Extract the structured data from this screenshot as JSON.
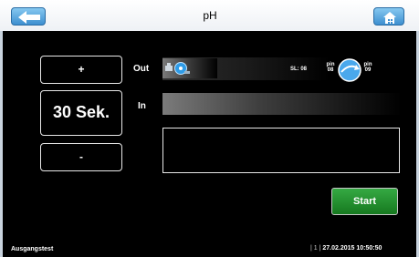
{
  "header": {
    "title": "pH"
  },
  "left_panel": {
    "plus_label": "+",
    "time_value": "30 Sek.",
    "minus_label": "-"
  },
  "out": {
    "label": "Out",
    "sl_label": "SL: 08",
    "pin_a": {
      "line1": "pin",
      "line2": "08"
    },
    "pin_b": {
      "line1": "pin",
      "line2": "09"
    }
  },
  "in": {
    "label": "In"
  },
  "start_label": "Start",
  "status": {
    "mode": "Ausgangstest",
    "counter": "| 1 |",
    "datetime": "27.02.2015 10:50:50"
  },
  "colors": {
    "header_button": "#3d8fd0",
    "start_button": "#1f8f2b"
  },
  "icons": [
    "back-arrow-icon",
    "home-icon",
    "pump-icon",
    "valve-icon"
  ]
}
